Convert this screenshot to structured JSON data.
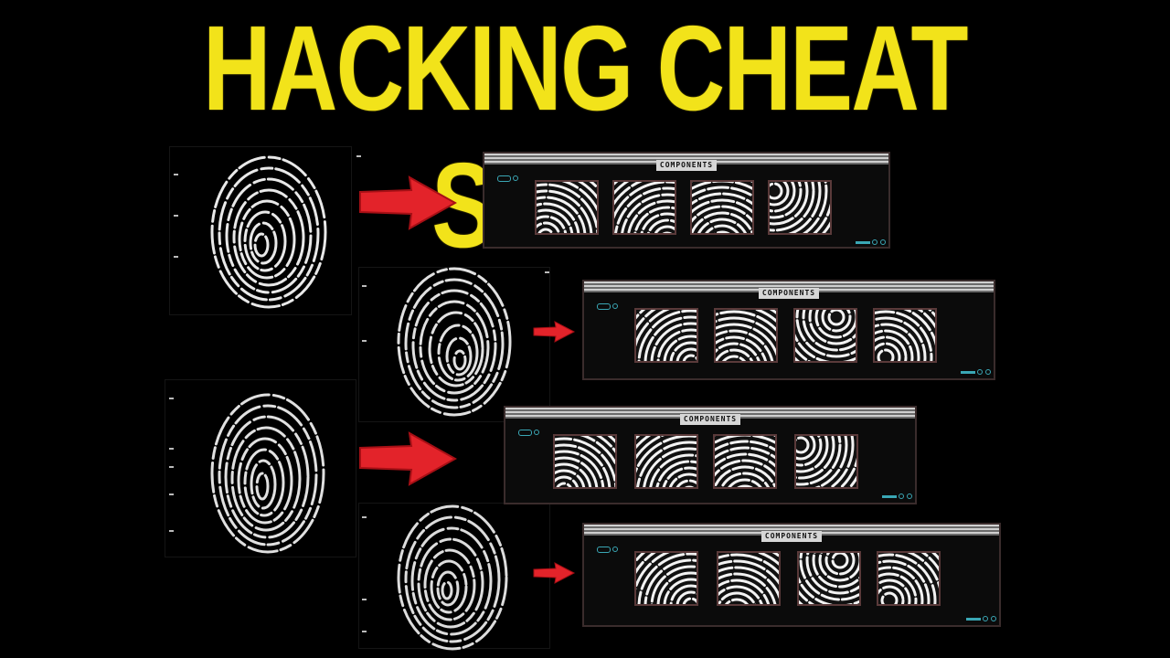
{
  "title": "HACKING CHEAT SHEET",
  "panel_label": "COMPONENTS",
  "colors": {
    "title": "#f2e31a",
    "arrow": "#e3232a",
    "background": "#000000",
    "accent": "#3aa7b5"
  },
  "icons": [
    "fingerprint-icon",
    "arrow-right-icon"
  ]
}
